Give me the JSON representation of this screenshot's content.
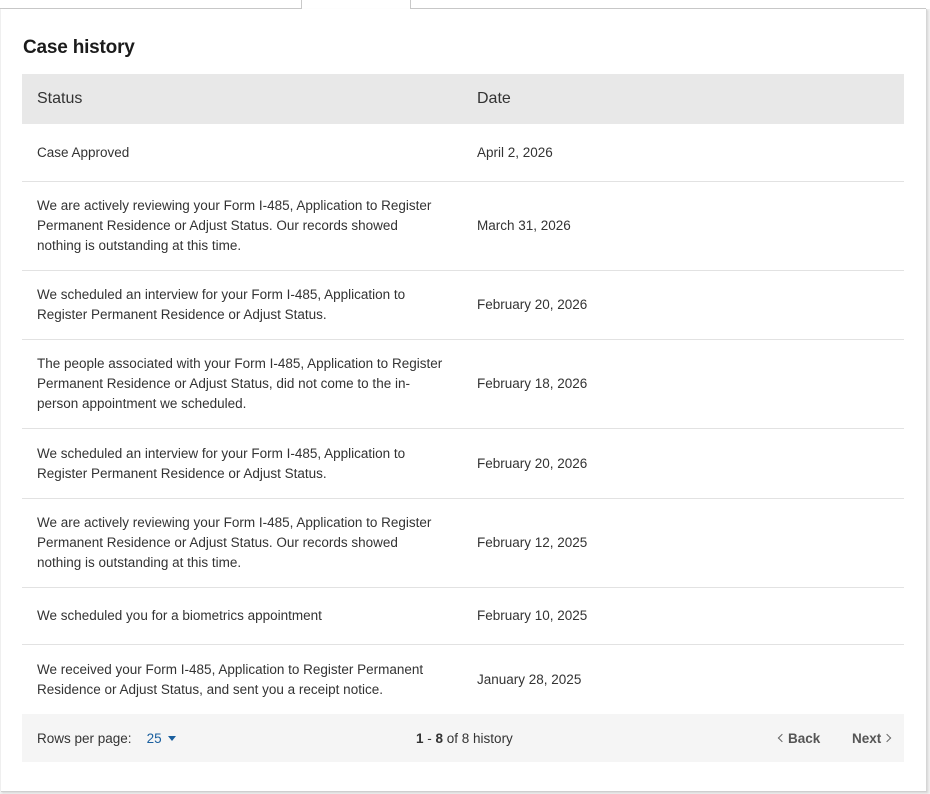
{
  "page_title": "Case history",
  "table": {
    "headers": {
      "status": "Status",
      "date": "Date"
    },
    "rows": [
      {
        "status": "Case Approved",
        "date": "April 2, 2026"
      },
      {
        "status": "We are actively reviewing your Form I-485, Application to Register Permanent Residence or Adjust Status. Our records showed nothing is outstanding at this time.",
        "date": "March 31, 2026"
      },
      {
        "status": "We scheduled an interview for your Form I-485, Application to Register Permanent Residence or Adjust Status.",
        "date": "February 20, 2026"
      },
      {
        "status": "The people associated with your Form I-485, Application to Register Permanent Residence or Adjust Status, did not come to the in-person appointment we scheduled.",
        "date": "February 18, 2026"
      },
      {
        "status": "We scheduled an interview for your Form I-485, Application to Register Permanent Residence or Adjust Status.",
        "date": "February 20, 2026"
      },
      {
        "status": "We are actively reviewing your Form I-485, Application to Register Permanent Residence or Adjust Status. Our records showed nothing is outstanding at this time.",
        "date": "February 12, 2025"
      },
      {
        "status": "We scheduled you for a biometrics appointment",
        "date": "February 10, 2025"
      },
      {
        "status": "We received your Form I-485, Application to Register Permanent Residence or Adjust Status, and sent you a receipt notice.",
        "date": "January 28, 2025"
      }
    ]
  },
  "pagination": {
    "rows_per_page_label": "Rows per page:",
    "rows_per_page_value": "25",
    "range_start": "1",
    "range_sep": " - ",
    "range_end": "8",
    "range_of_text": " of 8 history",
    "back_label": "Back",
    "next_label": "Next"
  },
  "icons": {
    "rows_per_page_dropdown": "caret-down-icon",
    "back": "chevron-left-icon",
    "next": "chevron-right-icon"
  },
  "colors": {
    "link_blue": "#1a5f9e",
    "header_bg": "#e8e8e8",
    "footer_bg": "#f5f5f5"
  }
}
